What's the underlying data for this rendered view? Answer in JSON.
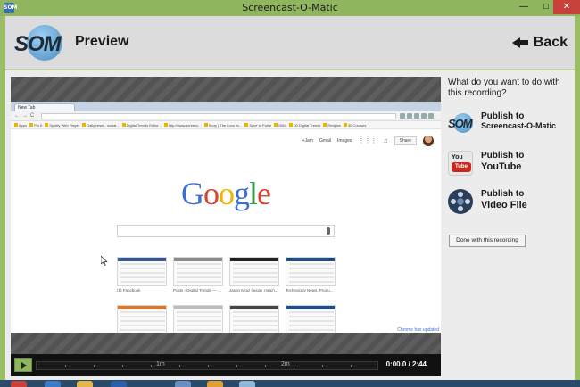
{
  "window": {
    "title": "Screencast-O-Matic",
    "app_icon_text": "SOM",
    "controls": {
      "minimize": "—",
      "maximize": "□",
      "close": "✕"
    }
  },
  "header": {
    "logo_text": "SOM",
    "title": "Preview",
    "back_label": "Back"
  },
  "player": {
    "browser": {
      "tab_label": "New Tab",
      "nav_glyphs": "←→C",
      "bookmarks": [
        "Apps",
        "Pin It",
        "Spotify Web Player",
        "Daily news - social...",
        "Digital Trends Editor...",
        "http://www.screenc...",
        "Story | The Loco fix...",
        "Save to Pulse",
        "GMU",
        "00 Digital Trends",
        "Recipes",
        "30 Courses"
      ],
      "google_links": [
        "+Jam",
        "Gmail",
        "Images"
      ],
      "share_label": "Share",
      "google_logo": [
        "G",
        "o",
        "o",
        "g",
        "l",
        "e"
      ],
      "thumbnails": [
        {
          "label": "(1) Facebook",
          "bar_color": "#3b5998"
        },
        {
          "label": "Posts ‹ Digital Trends — ...",
          "bar_color": "#8a8a8a"
        },
        {
          "label": "Jason Mraz (jason_mraz)...",
          "bar_color": "#222222"
        },
        {
          "label": "Technology News, Produ...",
          "bar_color": "#1e4f8a"
        },
        {
          "label": "",
          "bar_color": "#d9772e"
        },
        {
          "label": "",
          "bar_color": "#bbbbbb"
        },
        {
          "label": "",
          "bar_color": "#444444"
        },
        {
          "label": "",
          "bar_color": "#1e4f8a"
        }
      ],
      "chrome_updated": "Chrome has updated"
    },
    "timeline": {
      "tick_labels": [
        "1m",
        "2m"
      ],
      "current_time": "0:00.0",
      "separator": "/",
      "total_time": "2:44",
      "progress": 0.0
    }
  },
  "sidebar": {
    "question": "What do you want to do with this recording?",
    "options": [
      {
        "line1": "Publish to",
        "line2": "Screencast-O-Matic",
        "icon": "som-icon"
      },
      {
        "line1": "Publish to",
        "line2": "YouTube",
        "icon": "youtube-icon"
      },
      {
        "line1": "Publish to",
        "line2": "Video File",
        "icon": "film-reel-icon"
      }
    ],
    "done_label": "Done with this recording",
    "youtube_icon": {
      "you": "You",
      "tube": "Tube"
    }
  },
  "colors": {
    "window_frame": "#9bbd66",
    "accent_green": "#8fb55e",
    "player_bg": "#575757",
    "close_red": "#c7413a"
  }
}
